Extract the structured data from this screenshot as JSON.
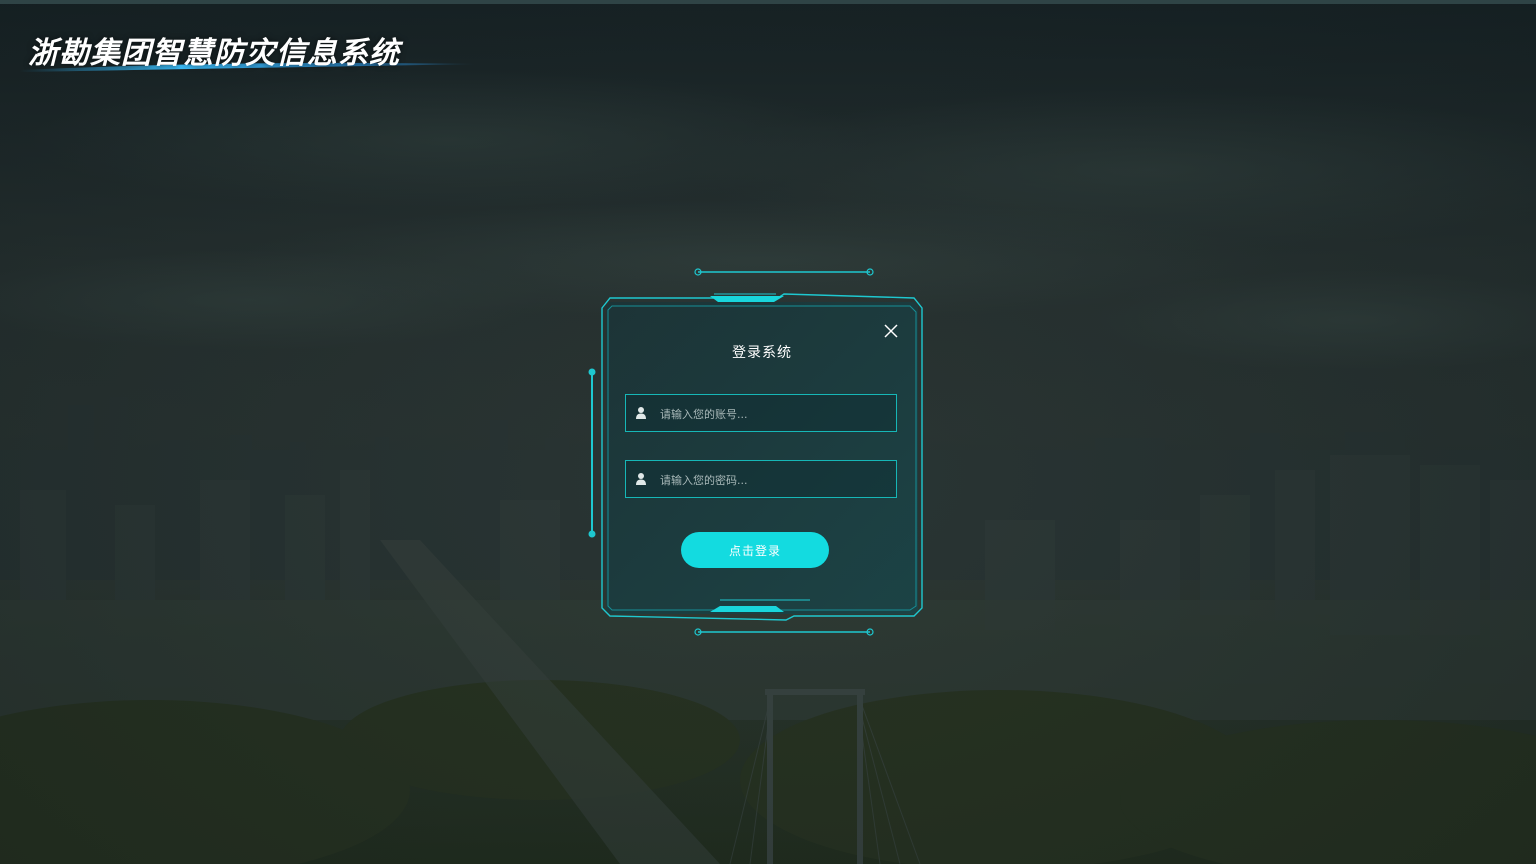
{
  "header": {
    "title": "浙勘集团智慧防灾信息系统"
  },
  "dialog": {
    "title": "登录系统",
    "close_icon": "close-icon",
    "account": {
      "placeholder": "请输入您的账号...",
      "icon": "user-icon"
    },
    "password": {
      "placeholder": "请输入您的密码...",
      "icon": "user-icon"
    },
    "login_label": "点击登录"
  },
  "colors": {
    "accent": "#13dbe0",
    "frame": "#1ec8d0",
    "panel": "#1e3a3b",
    "background": "#2a3433"
  }
}
